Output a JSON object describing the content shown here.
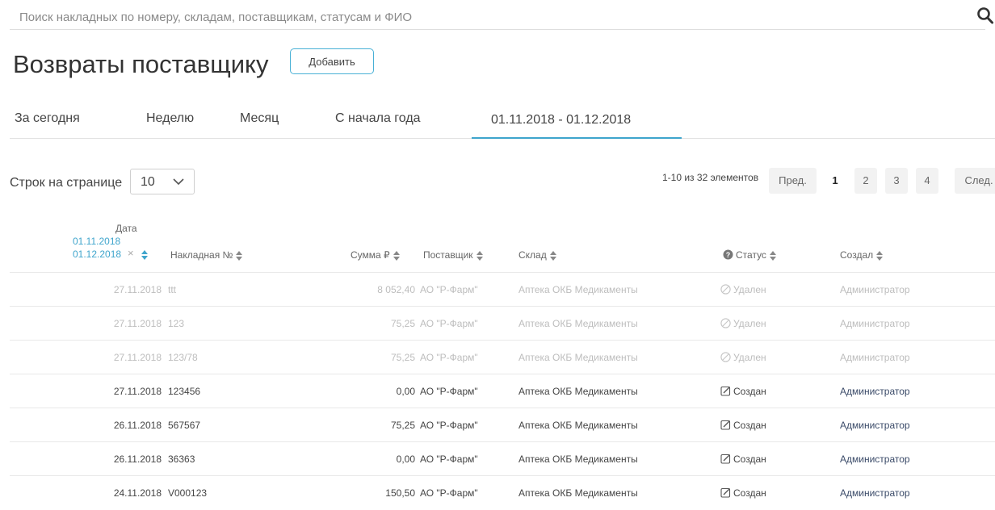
{
  "search": {
    "placeholder": "Поиск накладных по номеру, складам, поставщикам, статусам и ФИО"
  },
  "page": {
    "title": "Возвраты поставщику",
    "add_label": "Добавить"
  },
  "tabs": [
    {
      "label": "За сегодня"
    },
    {
      "label": "Неделю"
    },
    {
      "label": "Месяц"
    },
    {
      "label": "С начала года"
    },
    {
      "label": "01.11.2018 - 01.12.2018",
      "active": true
    }
  ],
  "page_size": {
    "label": "Строк на странице",
    "value": "10"
  },
  "pagination": {
    "info": "1-10 из 32 элементов",
    "prev": "Пред.",
    "pages": [
      "1",
      "2",
      "3",
      "4"
    ],
    "current": "1",
    "next": "След."
  },
  "columns": {
    "date": "Дата",
    "date_from": "01.11.2018",
    "date_to": "01.12.2018",
    "clear": "×",
    "invoice": "Накладная №",
    "sum": "Сумма ₽",
    "supplier": "Поставщик",
    "warehouse": "Склад",
    "status": "Статус",
    "author": "Создал"
  },
  "rows": [
    {
      "date": "27.11.2018",
      "invoice": "ttt",
      "sum": "8 052,40",
      "supplier": "АО \"Р-Фарм\"",
      "warehouse": "Аптека ОКБ Медикаменты",
      "status": "Удален",
      "author": "Администратор",
      "deleted": true
    },
    {
      "date": "27.11.2018",
      "invoice": "123",
      "sum": "75,25",
      "supplier": "АО \"Р-Фарм\"",
      "warehouse": "Аптека ОКБ Медикаменты",
      "status": "Удален",
      "author": "Администратор",
      "deleted": true
    },
    {
      "date": "27.11.2018",
      "invoice": "123/78",
      "sum": "75,25",
      "supplier": "АО \"Р-Фарм\"",
      "warehouse": "Аптека ОКБ Медикаменты",
      "status": "Удален",
      "author": "Администратор",
      "deleted": true
    },
    {
      "date": "27.11.2018",
      "invoice": "123456",
      "sum": "0,00",
      "supplier": "АО \"Р-Фарм\"",
      "warehouse": "Аптека ОКБ Медикаменты",
      "status": "Создан",
      "author": "Администратор",
      "deleted": false
    },
    {
      "date": "26.11.2018",
      "invoice": "567567",
      "sum": "75,25",
      "supplier": "АО \"Р-Фарм\"",
      "warehouse": "Аптека ОКБ Медикаменты",
      "status": "Создан",
      "author": "Администратор",
      "deleted": false
    },
    {
      "date": "26.11.2018",
      "invoice": "36363",
      "sum": "0,00",
      "supplier": "АО \"Р-Фарм\"",
      "warehouse": "Аптека ОКБ Медикаменты",
      "status": "Создан",
      "author": "Администратор",
      "deleted": false
    },
    {
      "date": "24.11.2018",
      "invoice": "V000123",
      "sum": "150,50",
      "supplier": "АО \"Р-Фарм\"",
      "warehouse": "Аптека ОКБ Медикаменты",
      "status": "Создан",
      "author": "Администратор",
      "deleted": false
    }
  ],
  "colors": {
    "accent": "#3fa5cc",
    "deleted_text": "#bdbdbd",
    "text": "#444444"
  }
}
